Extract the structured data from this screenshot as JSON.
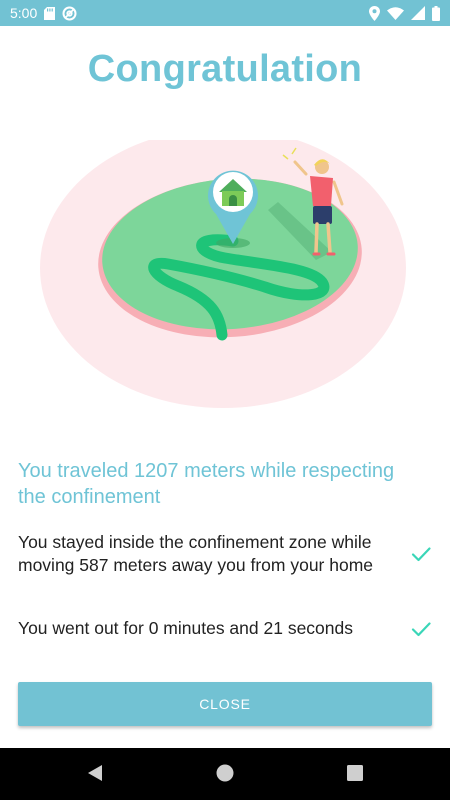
{
  "status_bar": {
    "time": "5:00",
    "icons": [
      "sd-card-icon",
      "at-sign-icon",
      "location-icon",
      "wifi-icon",
      "signal-icon",
      "battery-icon"
    ]
  },
  "title": "Congratulation",
  "summary": "You traveled 1207 meters while respecting the confinement",
  "checks": [
    {
      "text": "You stayed inside the confinement zone while moving 587 meters away you from your home",
      "icon": "check-icon"
    },
    {
      "text": "You went out for 0 minutes and 21 seconds",
      "icon": "check-icon"
    }
  ],
  "close_button": "CLOSE",
  "nav": [
    "back-icon",
    "home-icon",
    "recents-icon"
  ],
  "colors": {
    "accent": "#72c2d3",
    "title": "#6fc4d6",
    "check": "#3ad6b8",
    "zone_green": "#7dd69a",
    "path_green": "#1ec478",
    "halo_pink": "#fde9ec",
    "rim_pink": "#f7aeb5"
  }
}
